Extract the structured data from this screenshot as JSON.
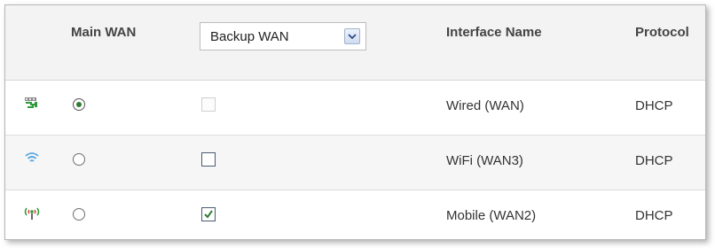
{
  "header": {
    "main_wan": "Main WAN",
    "backup_select": {
      "value": "Backup WAN"
    },
    "interface_name": "Interface Name",
    "protocol": "Protocol"
  },
  "rows": [
    {
      "icon": "ethernet-port-icon",
      "main_selected": true,
      "backup_checked": false,
      "backup_enabled": false,
      "name": "Wired (WAN)",
      "protocol": "DHCP"
    },
    {
      "icon": "wifi-signal-icon",
      "main_selected": false,
      "backup_checked": false,
      "backup_enabled": true,
      "name": "WiFi (WAN3)",
      "protocol": "DHCP"
    },
    {
      "icon": "mobile-antenna-icon",
      "main_selected": false,
      "backup_checked": true,
      "backup_enabled": true,
      "name": "Mobile (WAN2)",
      "protocol": "DHCP"
    }
  ],
  "colors": {
    "icon_green": "#2e9b3a",
    "icon_blue": "#5aa7e0",
    "check": "#2e7d32"
  }
}
